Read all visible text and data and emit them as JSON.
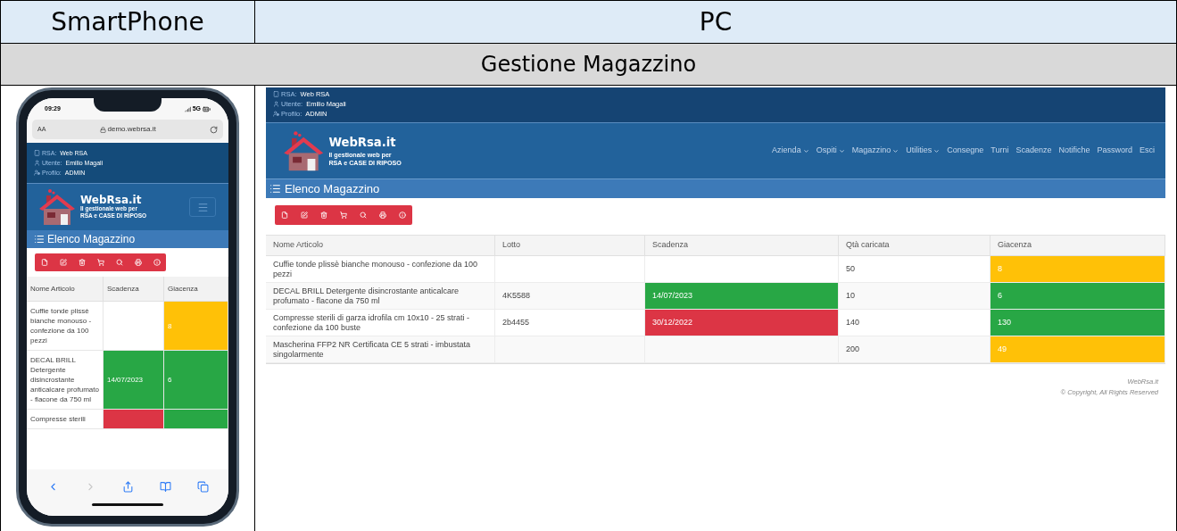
{
  "header": {
    "columns": [
      "SmartPhone",
      "PC"
    ]
  },
  "section_title": "Gestione Magazzino",
  "phone": {
    "status": {
      "time": "09:29",
      "network": "5G"
    },
    "browser": {
      "text_size": "AA",
      "url": "demo.webrsa.it",
      "forward_disabled": true
    },
    "info": [
      {
        "kind": "building",
        "label": "RSA:",
        "value": "Web RSA"
      },
      {
        "kind": "user",
        "label": "Utente:",
        "value": "Emilio Magali"
      },
      {
        "kind": "profile",
        "label": "Profilo:",
        "value": "ADMIN"
      }
    ],
    "logo": {
      "name": "WebRsa.it",
      "tagline": [
        "Il gestionale web per",
        "RSA e CASE DI RIPOSO"
      ]
    },
    "page_title": "Elenco Magazzino",
    "table": {
      "columns": [
        "Nome Articolo",
        "Scadenza",
        "Giacenza"
      ],
      "rows": [
        {
          "cells": [
            {
              "text": "Cuffie tonde plissè bianche monouso - confezione da 100 pezzi"
            },
            null,
            {
              "text": "8",
              "color": "#ffc107"
            }
          ]
        },
        {
          "cells": [
            {
              "text": "DECAL BRILL Detergente disincrostante anticalcare profumato - flacone da 750 ml"
            },
            {
              "text": "14/07/2023",
              "color": "#28a745"
            },
            {
              "text": "6",
              "color": "#28a745"
            }
          ]
        },
        {
          "cells": [
            {
              "text": "Compresse sterili"
            },
            {
              "color": "#dc3545"
            },
            {
              "color": "#28a745"
            }
          ]
        }
      ]
    }
  },
  "pc": {
    "info": [
      {
        "kind": "building",
        "label": "RSA:",
        "value": "Web RSA"
      },
      {
        "kind": "user",
        "label": "Utente:",
        "value": "Emilio Magali"
      },
      {
        "kind": "profile",
        "label": "Profilo:",
        "value": "ADMIN"
      }
    ],
    "logo": {
      "name": "WebRsa.it",
      "tagline": [
        "Il gestionale web per",
        "RSA e CASE DI RIPOSO"
      ]
    },
    "nav": [
      {
        "label": "Azienda",
        "dropdown": true
      },
      {
        "label": "Ospiti",
        "dropdown": true
      },
      {
        "label": "Magazzino",
        "dropdown": true
      },
      {
        "label": "Utilities",
        "dropdown": true
      },
      {
        "label": "Consegne",
        "dropdown": false
      },
      {
        "label": "Turni",
        "dropdown": false
      },
      {
        "label": "Scadenze",
        "dropdown": false
      },
      {
        "label": "Notifiche",
        "dropdown": false
      },
      {
        "label": "Password",
        "dropdown": false
      },
      {
        "label": "Esci",
        "dropdown": false
      }
    ],
    "page_title": "Elenco Magazzino",
    "table": {
      "columns": [
        "Nome Articolo",
        "Lotto",
        "Scadenza",
        "Qtà caricata",
        "Giacenza"
      ],
      "rows": [
        {
          "cells": [
            {
              "text": "Cuffie tonde plissè bianche monouso - confezione da 100 pezzi"
            },
            null,
            null,
            {
              "text": "50"
            },
            {
              "text": "8",
              "color": "#ffc107"
            }
          ]
        },
        {
          "cells": [
            {
              "text": "DECAL BRILL Detergente disincrostante anticalcare profumato - flacone da 750 ml"
            },
            {
              "text": "4K5588"
            },
            {
              "text": "14/07/2023",
              "color": "#28a745"
            },
            {
              "text": "10"
            },
            {
              "text": "6",
              "color": "#28a745"
            }
          ]
        },
        {
          "cells": [
            {
              "text": "Compresse sterili di garza idrofila cm 10x10 - 25 strati - confezione da 100 buste"
            },
            {
              "text": "2b4455"
            },
            {
              "text": "30/12/2022",
              "color": "#dc3545"
            },
            {
              "text": "140"
            },
            {
              "text": "130",
              "color": "#28a745"
            }
          ]
        },
        {
          "cells": [
            {
              "text": "Mascherina FFP2 NR Certificata CE 5 strati - imbustata singolarmente"
            },
            null,
            null,
            {
              "text": "200"
            },
            {
              "text": "49",
              "color": "#ffc107"
            }
          ]
        }
      ]
    },
    "footer": {
      "brand": "WebRsa.it",
      "copyright": "© Copyright, All Rights Reserved"
    }
  }
}
